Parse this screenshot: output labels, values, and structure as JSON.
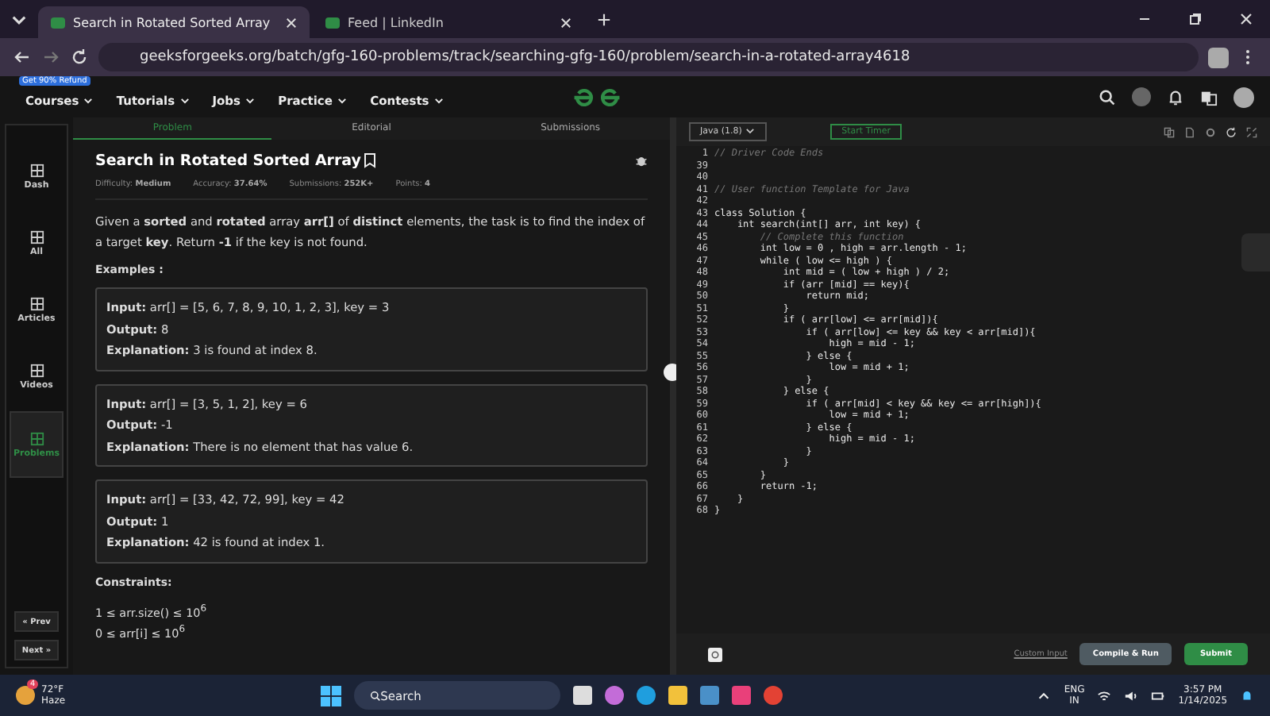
{
  "browser": {
    "tabs": [
      {
        "title": "Search in Rotated Sorted Array",
        "selected": true
      },
      {
        "title": "Feed | LinkedIn",
        "selected": false
      }
    ],
    "url": "geeksforgeeks.org/batch/gfg-160-problems/track/searching-gfg-160/problem/search-in-a-rotated-array4618"
  },
  "site_nav": {
    "badge": "Get 90% Refund",
    "items": [
      "Courses",
      "Tutorials",
      "Jobs",
      "Practice",
      "Contests"
    ]
  },
  "sidebar": {
    "items": [
      {
        "label": "Dash",
        "selected": false
      },
      {
        "label": "All",
        "selected": false
      },
      {
        "label": "Articles",
        "selected": false
      },
      {
        "label": "Videos",
        "selected": false
      },
      {
        "label": "Problems",
        "selected": true
      }
    ],
    "prev": "« Prev",
    "next": "Next »"
  },
  "problem_tabs": [
    {
      "label": "Problem",
      "selected": true
    },
    {
      "label": "Editorial",
      "selected": false
    },
    {
      "label": "Submissions",
      "selected": false
    }
  ],
  "problem": {
    "title": "Search in Rotated Sorted Array",
    "meta": [
      {
        "label": "Difficulty:",
        "value": "Medium"
      },
      {
        "label": "Accuracy:",
        "value": "37.64%"
      },
      {
        "label": "Submissions:",
        "value": "252K+"
      },
      {
        "label": "Points:",
        "value": "4"
      }
    ],
    "description": "Given a **sorted** and **rotated** array **arr[]** of **distinct** elements, the task is to find the index of a target **key**. Return **-1** if the key is not found.",
    "examples_heading": "Examples :",
    "examples": [
      {
        "rows": [
          {
            "label": "Input:",
            "text": "arr[] = [5, 6, 7, 8, 9, 10, 1, 2, 3], key = 3"
          },
          {
            "label": "Output:",
            "text": "8"
          },
          {
            "label": "Explanation:",
            "text": "3 is found at index 8."
          }
        ]
      },
      {
        "rows": [
          {
            "label": "Input:",
            "text": "arr[] = [3, 5, 1, 2], key = 6"
          },
          {
            "label": "Output:",
            "text": "-1"
          },
          {
            "label": "Explanation:",
            "text": "There is no element that has value 6."
          }
        ]
      },
      {
        "rows": [
          {
            "label": "Input:",
            "text": "arr[] = [33, 42, 72, 99], key = 42"
          },
          {
            "label": "Output:",
            "text": "1"
          },
          {
            "label": "Explanation:",
            "text": "42 is found at index 1."
          }
        ]
      }
    ],
    "constraints_heading": "Constraints:",
    "constraints": [
      "1 ≤ arr.size() ≤ 10$^{6}$",
      "0 ≤ arr[i] ≤ 10$^{6}$"
    ]
  },
  "editor": {
    "language": "Java (1.8)",
    "timer": "Start Timer",
    "lines": [
      {
        "num": "1",
        "kind": "comment",
        "text": "// Driver Code Ends"
      },
      {
        "num": "39"
      },
      {
        "num": "40"
      },
      {
        "num": "41",
        "kind": "comment",
        "text": "// User function Template for Java"
      },
      {
        "num": "42"
      },
      {
        "num": "43",
        "kind": "code",
        "text": "class Solution {"
      },
      {
        "num": "44",
        "kind": "code",
        "text": "    int search(int[] arr, int key) {"
      },
      {
        "num": "45",
        "kind": "comment",
        "text": "        // Complete this function"
      },
      {
        "num": "46",
        "kind": "code",
        "text": "        int low = 0 , high = arr.length - 1;"
      },
      {
        "num": "47",
        "kind": "code",
        "text": "        while ( low <= high ) {"
      },
      {
        "num": "48",
        "kind": "code",
        "text": "            int mid = ( low + high ) / 2;"
      },
      {
        "num": "49",
        "kind": "code",
        "text": "            if (arr [mid] == key){"
      },
      {
        "num": "50",
        "kind": "code",
        "text": "                return mid;"
      },
      {
        "num": "51",
        "kind": "code",
        "text": "            }"
      },
      {
        "num": "52",
        "kind": "code",
        "text": "            if ( arr[low] <= arr[mid]){"
      },
      {
        "num": "53",
        "kind": "code",
        "text": "                if ( arr[low] <= key && key < arr[mid]){"
      },
      {
        "num": "54",
        "kind": "code",
        "text": "                    high = mid - 1;"
      },
      {
        "num": "55",
        "kind": "code",
        "text": "                } else {"
      },
      {
        "num": "56",
        "kind": "code",
        "text": "                    low = mid + 1;"
      },
      {
        "num": "57",
        "kind": "code",
        "text": "                }"
      },
      {
        "num": "58",
        "kind": "code",
        "text": "            } else {"
      },
      {
        "num": "59",
        "kind": "code",
        "text": "                if ( arr[mid] < key && key <= arr[high]){"
      },
      {
        "num": "60",
        "kind": "code",
        "text": "                    low = mid + 1;"
      },
      {
        "num": "61",
        "kind": "code",
        "text": "                } else {"
      },
      {
        "num": "62",
        "kind": "code",
        "text": "                    high = mid - 1;"
      },
      {
        "num": "63",
        "kind": "code",
        "text": "                }"
      },
      {
        "num": "64",
        "kind": "code",
        "text": "            }"
      },
      {
        "num": "65",
        "kind": "code",
        "text": "        }"
      },
      {
        "num": "66",
        "kind": "code",
        "text": "        return -1;"
      },
      {
        "num": "67",
        "kind": "code",
        "text": "    }"
      },
      {
        "num": "68",
        "kind": "code",
        "text": "}"
      }
    ],
    "custom_input": "Custom Input",
    "compile": "Compile & Run",
    "submit": "Submit"
  },
  "taskbar": {
    "temperature": "72°F",
    "weather": "Haze",
    "weather_badge": "4",
    "search_placeholder": "Search",
    "language": "ENG",
    "region": "IN",
    "time": "3:57 PM",
    "date": "1/14/2025"
  }
}
